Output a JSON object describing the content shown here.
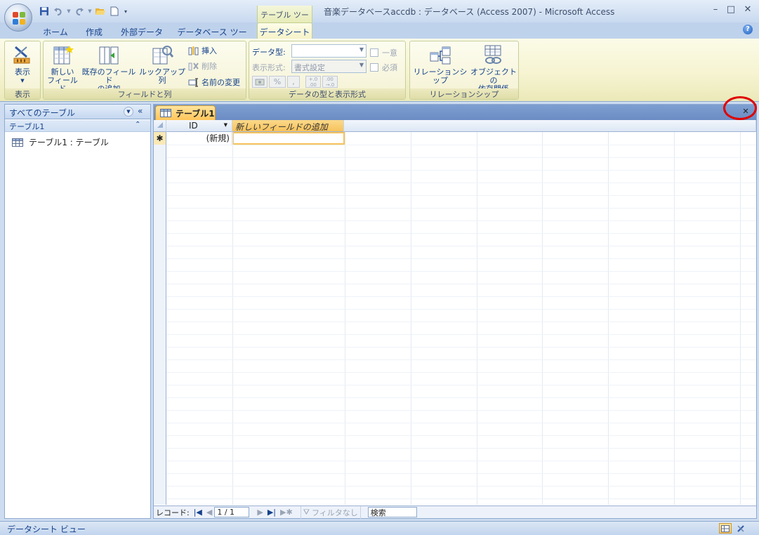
{
  "window": {
    "title": "音楽データベースaccdb : データベース (Access 2007) - Microsoft Access",
    "tool_context": "テーブル ツール",
    "controls": [
      "–",
      "□",
      "✕"
    ]
  },
  "tabs": [
    {
      "label": "ホーム",
      "active": false
    },
    {
      "label": "作成",
      "active": false
    },
    {
      "label": "外部データ",
      "active": false
    },
    {
      "label": "データベース ツール",
      "active": false
    },
    {
      "label": "データシート",
      "active": true
    }
  ],
  "ribbon": {
    "view_group": {
      "label": "表示",
      "button": "表示"
    },
    "fields_group": {
      "label": "フィールドと列",
      "new_field": [
        "新しい",
        "フィールド"
      ],
      "add_existing": [
        "既存のフィールド",
        "の追加"
      ],
      "lookup_column": "ルックアップ列",
      "insert": "挿入",
      "delete": "削除",
      "rename": "名前の変更"
    },
    "datatype_group": {
      "label": "データの型と表示形式",
      "data_type_label": "データ型:",
      "data_type_value": "",
      "format_label": "表示形式:",
      "format_value": "書式設定",
      "unique": "一意",
      "required": "必須",
      "percent": "%"
    },
    "relationship_group": {
      "label": "リレーションシップ",
      "relationships": "リレーションシップ",
      "object_dependencies": [
        "オブジェクトの",
        "依存関係"
      ]
    }
  },
  "nav_pane": {
    "header": "すべてのテーブル",
    "group_name": "テーブル1",
    "items": [
      {
        "label": "テーブル1 : テーブル",
        "icon": "table-icon"
      }
    ]
  },
  "document": {
    "tab_label": "テーブル1",
    "columns": [
      {
        "label": "ID"
      },
      {
        "label": "新しいフィールドの追加"
      }
    ],
    "new_row": {
      "marker": "✱",
      "id_value": "(新規)"
    }
  },
  "record_nav": {
    "label": "レコード:",
    "position": "1 / 1",
    "filter": "フィルタなし",
    "search": "検索"
  },
  "status_bar": {
    "text": "データシート ビュー"
  },
  "colors": {
    "highlight_ring": "#e00000",
    "active_tab": "#f6f3c9",
    "doc_tab": "#ffc55a",
    "new_field_header": "#f7c25a"
  }
}
